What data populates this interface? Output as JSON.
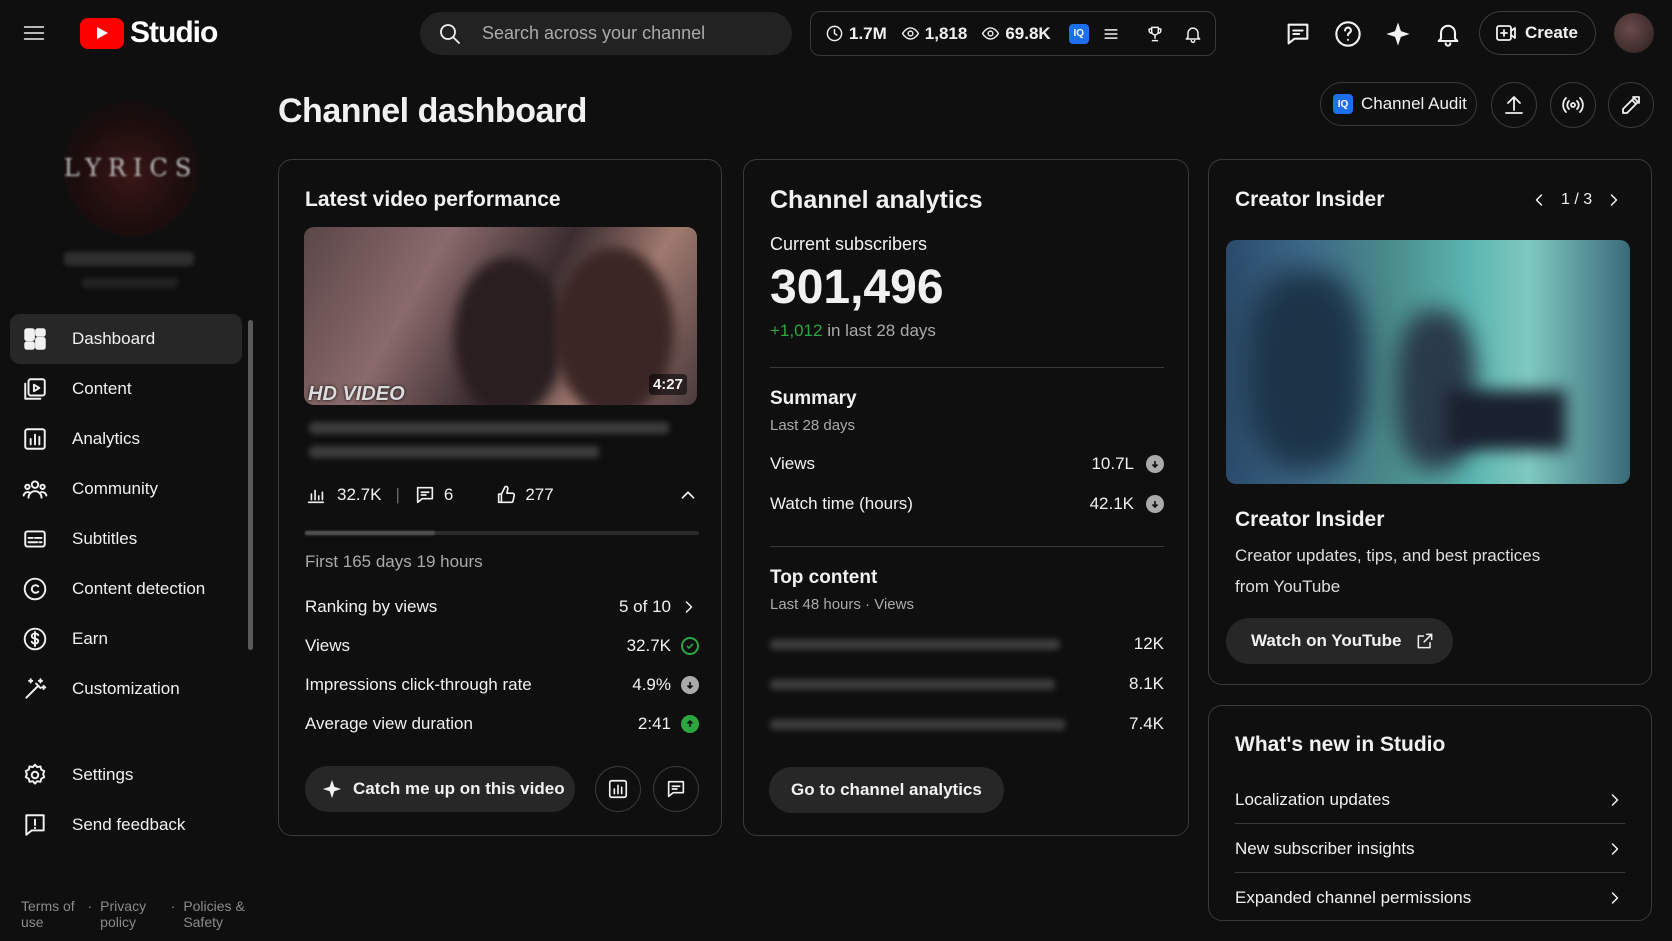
{
  "header": {
    "logo_text": "Studio",
    "search_placeholder": "Search across your channel",
    "stats": [
      "1.7M",
      "1,818",
      "69.8K"
    ],
    "create_label": "Create"
  },
  "page": {
    "title": "Channel dashboard",
    "channel_audit_label": "Channel Audit",
    "iq_badge": "IQ"
  },
  "sidebar": {
    "channel_logo_text": "LYRICS",
    "items": [
      {
        "label": "Dashboard",
        "icon": "dashboard-icon"
      },
      {
        "label": "Content",
        "icon": "content-icon"
      },
      {
        "label": "Analytics",
        "icon": "analytics-icon"
      },
      {
        "label": "Community",
        "icon": "community-icon"
      },
      {
        "label": "Subtitles",
        "icon": "subtitles-icon"
      },
      {
        "label": "Content detection",
        "icon": "copyright-icon"
      },
      {
        "label": "Earn",
        "icon": "dollar-icon"
      },
      {
        "label": "Customization",
        "icon": "magic-wand-icon"
      }
    ],
    "settings_label": "Settings",
    "feedback_label": "Send feedback",
    "footer": [
      "Terms of use",
      "Privacy policy",
      "Policies & Safety"
    ]
  },
  "latest_video": {
    "title": "Latest video performance",
    "duration": "4:27",
    "thumb_overlay": "HD VIDEO",
    "views_short": "32.7K",
    "comments": "6",
    "likes": "277",
    "period": "First 165 days 19 hours",
    "ranking_label": "Ranking by views",
    "ranking_value": "5 of 10",
    "views_label": "Views",
    "views_value": "32.7K",
    "ctr_label": "Impressions click-through rate",
    "ctr_value": "4.9%",
    "avd_label": "Average view duration",
    "avd_value": "2:41",
    "catch_up_label": "Catch me up on this video"
  },
  "channel_analytics": {
    "title": "Channel analytics",
    "subs_label": "Current subscribers",
    "subs_value": "301,496",
    "subs_change": "+1,012",
    "subs_change_suffix": "in last 28 days",
    "summary_title": "Summary",
    "summary_period": "Last 28 days",
    "views_label": "Views",
    "views_value": "10.7L",
    "watch_label": "Watch time (hours)",
    "watch_value": "42.1K",
    "top_title": "Top content",
    "top_period": "Last 48 hours · Views",
    "top_values": [
      "12K",
      "8.1K",
      "7.4K"
    ],
    "go_button": "Go to channel analytics"
  },
  "creator_insider": {
    "title": "Creator Insider",
    "pager": "1 / 3",
    "video_title": "Creator Insider",
    "description": "Creator updates, tips, and best practices from YouTube",
    "watch_label": "Watch on YouTube"
  },
  "whats_new": {
    "title": "What's new in Studio",
    "items": [
      "Localization updates",
      "New subscriber insights",
      "Expanded channel permissions"
    ]
  },
  "colors": {
    "accent_red": "#ff0000",
    "positive_green": "#2ba640",
    "background": "#0f0f0f"
  }
}
